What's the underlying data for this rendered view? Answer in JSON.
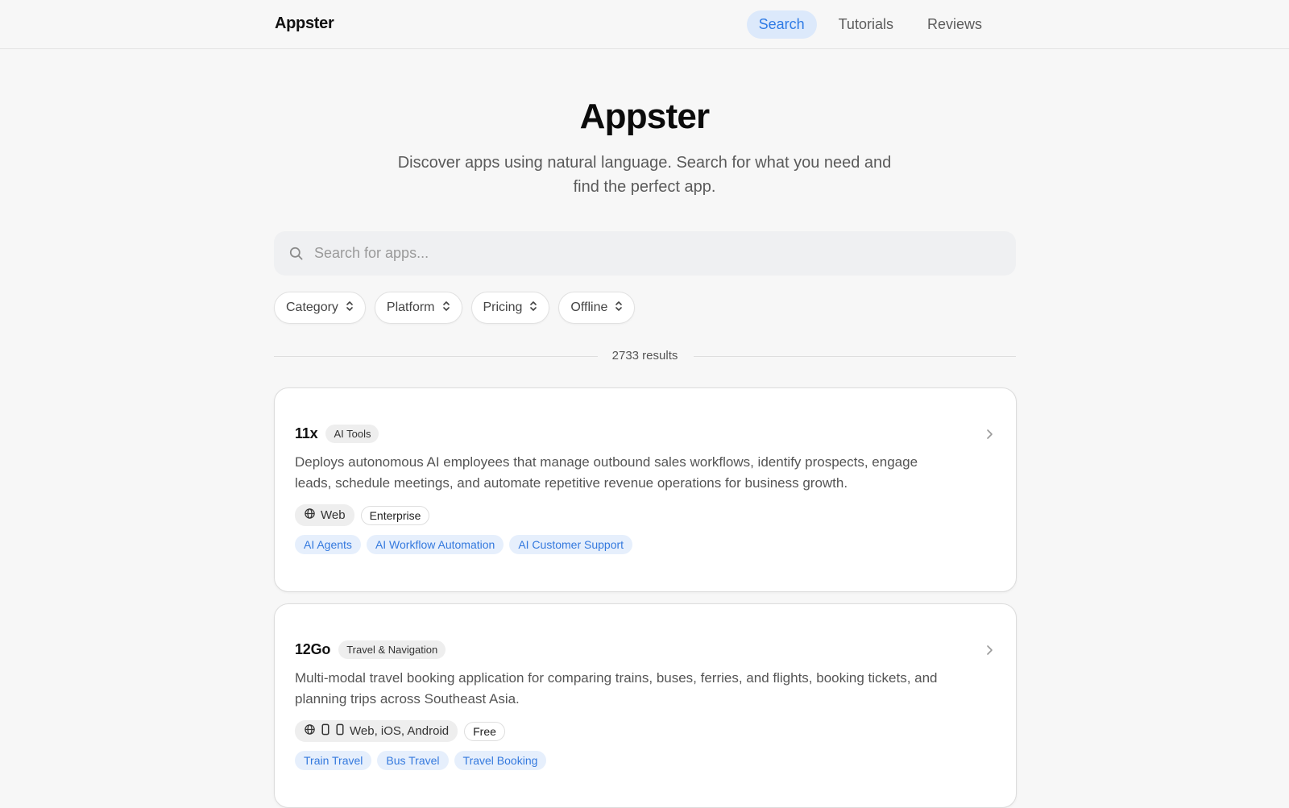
{
  "nav": {
    "brand": "Appster",
    "links": [
      {
        "label": "Search",
        "active": true
      },
      {
        "label": "Tutorials",
        "active": false
      },
      {
        "label": "Reviews",
        "active": false
      }
    ]
  },
  "hero": {
    "title": "Appster",
    "subtitle": "Discover apps using natural language. Search for what you need and find the perfect app."
  },
  "search": {
    "placeholder": "Search for apps...",
    "value": "",
    "icon": "search-icon"
  },
  "filters": [
    {
      "label": "Category"
    },
    {
      "label": "Platform"
    },
    {
      "label": "Pricing"
    },
    {
      "label": "Offline"
    }
  ],
  "results": {
    "count_text": "2733 results"
  },
  "apps": [
    {
      "name": "11x",
      "category": "AI Tools",
      "description": "Deploys autonomous AI employees that manage outbound sales workflows, identify prospects, engage leads, schedule meetings, and automate repetitive revenue operations for business growth.",
      "platforms_text": "Web",
      "platform_icons": [
        "globe-icon"
      ],
      "pricing": "Enterprise",
      "tags": [
        "AI Agents",
        "AI Workflow Automation",
        "AI Customer Support"
      ]
    },
    {
      "name": "12Go",
      "category": "Travel & Navigation",
      "description": "Multi-modal travel booking application for comparing trains, buses, ferries, and flights, booking tickets, and planning trips across Southeast Asia.",
      "platforms_text": "Web, iOS, Android",
      "platform_icons": [
        "globe-icon",
        "phone-icon",
        "phone-icon"
      ],
      "pricing": "Free",
      "tags": [
        "Train Travel",
        "Bus Travel",
        "Travel Booking"
      ]
    }
  ],
  "colors": {
    "accent": "#2f7be5",
    "accent_bg": "#dce9fb",
    "tag_text": "#3479de",
    "tag_bg": "#e6effc"
  }
}
